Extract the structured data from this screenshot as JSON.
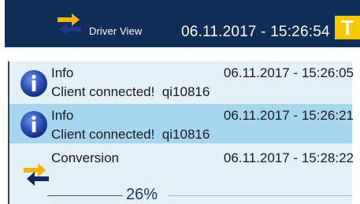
{
  "topbar": {
    "swap_icon": "swap-arrows-icon",
    "view_label": "Driver View",
    "clock": "06.11.2017 - 15:26:54",
    "badge_letter": "T",
    "colors": {
      "background": "#0f2d57",
      "badge": "#f5c800",
      "arrow_yellow": "#f5b400"
    }
  },
  "log": {
    "rows": [
      {
        "icon": "info-icon",
        "title": "Info",
        "time": "06.11.2017 - 15:26:05",
        "message": "Client connected!  qi10816",
        "selected": false
      },
      {
        "icon": "info-icon",
        "title": "Info",
        "time": "06.11.2017 - 15:26:21",
        "message": "Client connected!  qi10816",
        "selected": true
      },
      {
        "icon": "swap-arrows-icon",
        "title": "Conversion",
        "time": "06.11.2017 - 15:28:22",
        "progress_percent": 26,
        "progress_label": "26%",
        "selected": false
      }
    ],
    "colors": {
      "panel": "#e3f0f7",
      "selected_row": "#a6d6ee"
    }
  }
}
